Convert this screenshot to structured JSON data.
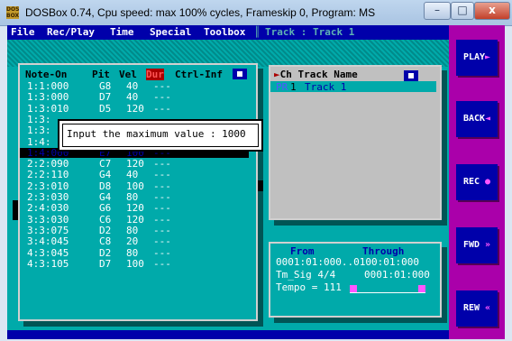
{
  "window": {
    "title": "DOSBox 0.74, Cpu speed: max 100% cycles, Frameskip  0, Program:     MS",
    "icon_text": "DOS BOX",
    "minimize": "–",
    "maximize": "□",
    "close": "x"
  },
  "menu": {
    "items": [
      "File",
      "Rec/Play",
      "Time",
      "Special",
      "Toolbox"
    ],
    "separator": "║",
    "track_label": "Track : Track  1"
  },
  "events": {
    "headers": {
      "note": "Note-On",
      "pit": "Pit",
      "vel": "Vel",
      "dur": "Dur",
      "ctrl": "Ctrl-Inf"
    },
    "rows": [
      {
        "time": "1:1:000",
        "pit": "G8",
        "vel": "40",
        "dur": "---"
      },
      {
        "time": "1:3:000",
        "pit": "D7",
        "vel": "40",
        "dur": "---"
      },
      {
        "time": "1:3:010",
        "pit": "D5",
        "vel": "120",
        "dur": "---"
      },
      {
        "time": "1:3:",
        "pit": "",
        "vel": "",
        "dur": ""
      },
      {
        "time": "1:3:",
        "pit": "",
        "vel": "",
        "dur": ""
      },
      {
        "time": "1:4:",
        "pit": "",
        "vel": "",
        "dur": ""
      },
      {
        "time": "1:4:000",
        "pit": "E7",
        "vel": "100",
        "dur": "---"
      },
      {
        "time": "2:2:090",
        "pit": "C7",
        "vel": "120",
        "dur": "---"
      },
      {
        "time": "2:2:110",
        "pit": "G4",
        "vel": "40",
        "dur": "---"
      },
      {
        "time": "2:3:010",
        "pit": "D8",
        "vel": "100",
        "dur": "---"
      },
      {
        "time": "2:3:030",
        "pit": "G4",
        "vel": "80",
        "dur": "---"
      },
      {
        "time": "2:4:030",
        "pit": "G6",
        "vel": "120",
        "dur": "---"
      },
      {
        "time": "3:3:030",
        "pit": "C6",
        "vel": "120",
        "dur": "---"
      },
      {
        "time": "3:3:075",
        "pit": "D2",
        "vel": "80",
        "dur": "---"
      },
      {
        "time": "3:4:045",
        "pit": "C8",
        "vel": "20",
        "dur": "---"
      },
      {
        "time": "4:3:045",
        "pit": "D2",
        "vel": "80",
        "dur": "---"
      },
      {
        "time": "4:3:105",
        "pit": "D7",
        "vel": "100",
        "dur": "---"
      }
    ]
  },
  "dialog": {
    "prompt": "Input the maximum value : 1000"
  },
  "tracks": {
    "header": "Ch Track Name",
    "items": [
      {
        "flag": "PR",
        "ch": "1",
        "name": "Track  1"
      }
    ]
  },
  "range": {
    "from_label": "From",
    "through_label": "Through",
    "range_value": "0001:01:000..0100:01:000",
    "time_sig": "Tm_Sig 4/4",
    "time_sig_pos": "0001:01:000",
    "tempo": "Tempo = 111"
  },
  "transport": [
    {
      "label": "PLAY",
      "glyph": "►"
    },
    {
      "label": "BACK",
      "glyph": "◄"
    },
    {
      "label": "REC",
      "glyph": "●"
    },
    {
      "label": "FWD",
      "glyph": "»"
    },
    {
      "label": "REW",
      "glyph": "«"
    }
  ]
}
